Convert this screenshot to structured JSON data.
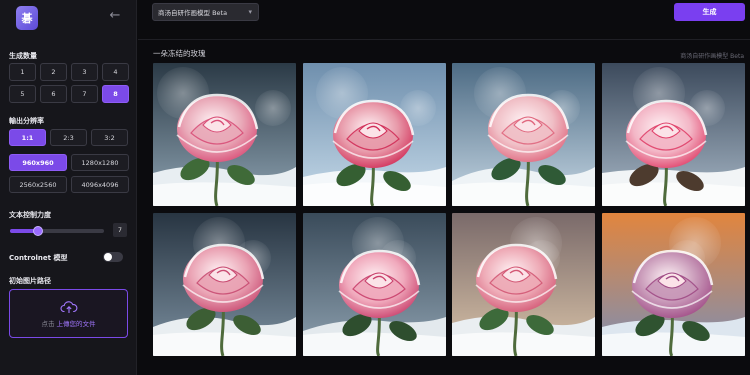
{
  "app": {
    "logo_text": "碁"
  },
  "sidebar": {
    "count_label": "生成数量",
    "counts": [
      "1",
      "2",
      "3",
      "4",
      "5",
      "6",
      "7",
      "8"
    ],
    "ratio_label": "輸出分辨率",
    "ratios": [
      "1:1",
      "2:3",
      "3:2"
    ],
    "sizes": [
      "960x960",
      "1280x1280",
      "2560x2560",
      "4096x4096"
    ],
    "text_control_label": "文本控制力度",
    "text_control_value": "7",
    "text_control_level": 0.3,
    "controlnet_label": "Controlnet 模型",
    "controlnet_enabled": false,
    "init_image_label": "初始图片路径",
    "upload_prefix": "点击",
    "upload_link": "上傳您的文件"
  },
  "topbar": {
    "model": "商汤自研作画模型 Beta",
    "generate_label": "生成"
  },
  "gallery": {
    "prompt": "一朵冻结的玫瑰",
    "model_tag": "商汤自研作画模型 Beta",
    "images": [
      {
        "alt": "frozen-rose-1",
        "petal": "#e9a9b8",
        "edge": "#d94f78",
        "bg1": "#2b3a46",
        "bg2": "#8fa4b3",
        "snow": "#e8eef2",
        "leaf": "#3f6a38"
      },
      {
        "alt": "frozen-rose-2",
        "petal": "#e89aaa",
        "edge": "#d12e58",
        "bg1": "#6f8fad",
        "bg2": "#c7dbea",
        "snow": "#f3f7fa",
        "leaf": "#355f32"
      },
      {
        "alt": "frozen-rose-3",
        "petal": "#f0bfc6",
        "edge": "#e0687f",
        "bg1": "#4d6b84",
        "bg2": "#c6d7e4",
        "snow": "#eef3f6",
        "leaf": "#2f5a36"
      },
      {
        "alt": "frozen-rose-4",
        "petal": "#f3b6c6",
        "edge": "#e0416a",
        "bg1": "#3c4a5c",
        "bg2": "#a9b9c8",
        "snow": "#f1f4f6",
        "leaf": "#4d3b2e"
      },
      {
        "alt": "frozen-rose-5",
        "petal": "#eaa3b4",
        "edge": "#c94d73",
        "bg1": "#283542",
        "bg2": "#7c90a0",
        "snow": "#e9eef1",
        "leaf": "#3c5e34"
      },
      {
        "alt": "frozen-rose-6",
        "petal": "#f0a9bc",
        "edge": "#c9406c",
        "bg1": "#3a4b5a",
        "bg2": "#8ea1b0",
        "snow": "#e3e9ed",
        "leaf": "#2e4e2e"
      },
      {
        "alt": "frozen-rose-7",
        "petal": "#eeaab6",
        "edge": "#d35875",
        "bg1": "#7a6a6a",
        "bg2": "#d9c3a8",
        "snow": "#eaeef1",
        "leaf": "#3d6a3a"
      },
      {
        "alt": "frozen-rose-8",
        "petal": "#c898b8",
        "edge": "#a04c86",
        "bg1": "#e1853e",
        "bg2": "#7d8fb4",
        "snow": "#dde6ef",
        "leaf": "#2f5330"
      }
    ]
  },
  "colors": {
    "accent": "#7b4ae8",
    "bg": "#0b0b0e",
    "sidebar": "#16161b"
  }
}
